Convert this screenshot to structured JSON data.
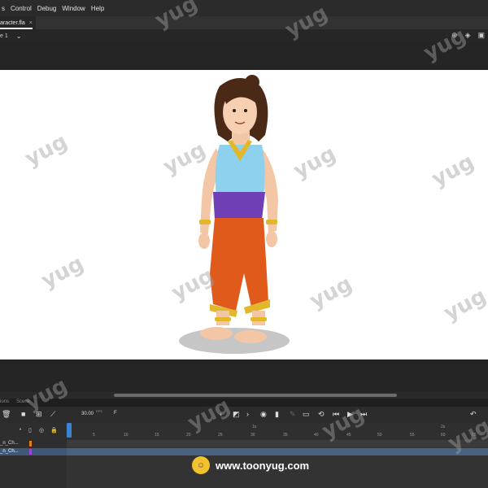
{
  "menu": {
    "items": [
      "s",
      "Control",
      "Debug",
      "Window",
      "Help"
    ]
  },
  "document_tab": {
    "label": "aracter.fla",
    "close": "×"
  },
  "scene": {
    "label": "e 1",
    "chevron": "⌄"
  },
  "timeline": {
    "panel_tabs": [
      "ions",
      "Scene"
    ],
    "fps_value": "30.00",
    "fps_unit": "FPS",
    "frame_field": "F",
    "ruler_numbers": [
      "5",
      "10",
      "15",
      "20",
      "25",
      "30",
      "35",
      "40",
      "45",
      "50",
      "55",
      "60",
      "65"
    ],
    "ruler_seconds": [
      "1s",
      "2s"
    ],
    "layers": [
      {
        "name": "_n_Ch...",
        "color": "#e87b1e"
      },
      {
        "name": "_n_Ch...",
        "color": "#9b43d6"
      }
    ]
  },
  "watermark": {
    "text": "yug"
  },
  "footer": {
    "url": "www.toonyug.com"
  },
  "colors": {
    "stage_bg": "#ffffff",
    "app_bg": "#1e1e1e",
    "playhead": "#3a84d6",
    "selected_layer": "#3d5879"
  }
}
